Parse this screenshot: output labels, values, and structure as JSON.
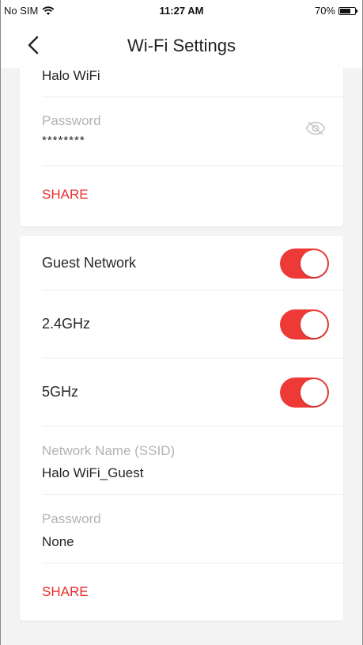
{
  "status_bar": {
    "carrier": "No SIM",
    "time": "11:27 AM",
    "battery_percent": "70%",
    "battery_level": 0.7,
    "wifi_icon": "wifi-icon"
  },
  "nav": {
    "title": "Wi-Fi Settings",
    "back_icon": "chevron-left-icon"
  },
  "main_network": {
    "ssid_value": "Halo WiFi",
    "password_label": "Password",
    "password_value": "********",
    "visibility_icon": "eye-hidden-icon",
    "share_label": "SHARE"
  },
  "guest_network": {
    "guest_label": "Guest Network",
    "guest_enabled": true,
    "band_24_label": "2.4GHz",
    "band_24_enabled": true,
    "band_5_label": "5GHz",
    "band_5_enabled": true,
    "ssid_label": "Network Name (SSID)",
    "ssid_value": "Halo WiFi_Guest",
    "password_label": "Password",
    "password_value": "None",
    "share_label": "SHARE"
  },
  "colors": {
    "accent": "#ee3a36",
    "share_text": "#e8312f",
    "muted_text": "#b3b3b3",
    "background": "#f4f4f5"
  }
}
